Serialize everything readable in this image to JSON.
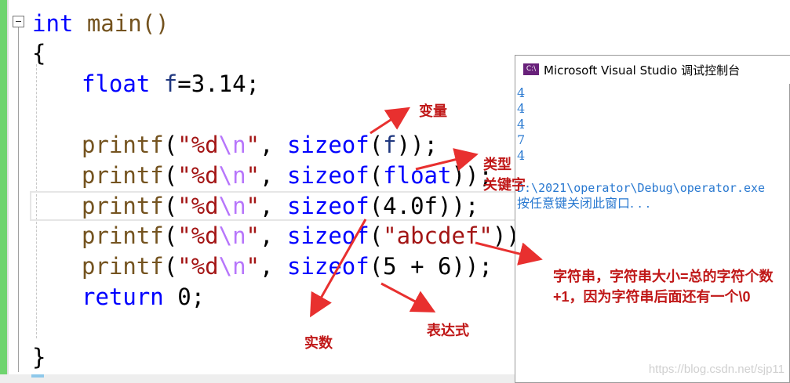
{
  "editor": {
    "lines": [
      {
        "id": "l1",
        "parts": [
          {
            "t": "int",
            "c": "kw"
          },
          {
            "t": " main()",
            "c": "fn"
          }
        ]
      },
      {
        "id": "l2",
        "parts": [
          {
            "t": "{",
            "c": "num"
          }
        ]
      },
      {
        "id": "l3",
        "parts": [
          {
            "t": "float",
            "c": "kw"
          },
          {
            "t": " f",
            "c": "var"
          },
          {
            "t": "=3.14;",
            "c": "num"
          }
        ]
      },
      {
        "id": "l4",
        "parts": []
      },
      {
        "id": "l5",
        "parts": [
          {
            "t": "printf",
            "c": "fn"
          },
          {
            "t": "(",
            "c": "num"
          },
          {
            "t": "\"%d",
            "c": "str"
          },
          {
            "t": "\\n",
            "c": "esc"
          },
          {
            "t": "\"",
            "c": "str"
          },
          {
            "t": ", ",
            "c": "num"
          },
          {
            "t": "sizeof",
            "c": "kw"
          },
          {
            "t": "(",
            "c": "num"
          },
          {
            "t": "f",
            "c": "var"
          },
          {
            "t": "));",
            "c": "num"
          }
        ]
      },
      {
        "id": "l6",
        "parts": [
          {
            "t": "printf",
            "c": "fn"
          },
          {
            "t": "(",
            "c": "num"
          },
          {
            "t": "\"%d",
            "c": "str"
          },
          {
            "t": "\\n",
            "c": "esc"
          },
          {
            "t": "\"",
            "c": "str"
          },
          {
            "t": ", ",
            "c": "num"
          },
          {
            "t": "sizeof",
            "c": "kw"
          },
          {
            "t": "(",
            "c": "num"
          },
          {
            "t": "float",
            "c": "kw"
          },
          {
            "t": "));",
            "c": "num"
          }
        ]
      },
      {
        "id": "l7",
        "parts": [
          {
            "t": "printf",
            "c": "fn"
          },
          {
            "t": "(",
            "c": "num"
          },
          {
            "t": "\"%d",
            "c": "str"
          },
          {
            "t": "\\n",
            "c": "esc"
          },
          {
            "t": "\"",
            "c": "str"
          },
          {
            "t": ", ",
            "c": "num"
          },
          {
            "t": "sizeof",
            "c": "kw"
          },
          {
            "t": "(4.0f));",
            "c": "num"
          }
        ]
      },
      {
        "id": "l8",
        "parts": [
          {
            "t": "printf",
            "c": "fn"
          },
          {
            "t": "(",
            "c": "num"
          },
          {
            "t": "\"%d",
            "c": "str"
          },
          {
            "t": "\\n",
            "c": "esc"
          },
          {
            "t": "\"",
            "c": "str"
          },
          {
            "t": ", ",
            "c": "num"
          },
          {
            "t": "sizeof",
            "c": "kw"
          },
          {
            "t": "(",
            "c": "num"
          },
          {
            "t": "\"abcdef\"",
            "c": "str"
          },
          {
            "t": "));",
            "c": "num"
          }
        ]
      },
      {
        "id": "l9",
        "parts": [
          {
            "t": "printf",
            "c": "fn"
          },
          {
            "t": "(",
            "c": "num"
          },
          {
            "t": "\"%d",
            "c": "str"
          },
          {
            "t": "\\n",
            "c": "esc"
          },
          {
            "t": "\"",
            "c": "str"
          },
          {
            "t": ", ",
            "c": "num"
          },
          {
            "t": "sizeof",
            "c": "kw"
          },
          {
            "t": "(5 + 6));",
            "c": "num"
          }
        ]
      },
      {
        "id": "l10",
        "parts": [
          {
            "t": "return",
            "c": "kw"
          },
          {
            "t": " 0;",
            "c": "num"
          }
        ]
      },
      {
        "id": "l11",
        "parts": []
      },
      {
        "id": "l12",
        "parts": [
          {
            "t": "}",
            "c": "num"
          }
        ]
      }
    ]
  },
  "annotations": {
    "variable": "变量",
    "type_keyword_1": "类型",
    "type_keyword_2": "关键字",
    "real_number": "实数",
    "expression": "表达式",
    "string_note": "字符串，字符串大小=总的字符个数+1，因为字符串后面还有一个\\0"
  },
  "console": {
    "title": "Microsoft Visual Studio 调试控制台",
    "icon_label": "C:\\",
    "outputs": [
      "4",
      "4",
      "4",
      "7",
      "4"
    ],
    "path_line": "D:\\2021\\operator\\Debug\\operator.exe",
    "prompt": "按任意键关闭此窗口. . ."
  },
  "watermark": "https://blog.csdn.net/sjp11",
  "colors": {
    "keyword": "#0000ff",
    "function": "#74531f",
    "string": "#a31515",
    "escape": "#b776fb",
    "variable": "#1f377f",
    "annotation": "#c01818",
    "arrow": "#e8302f",
    "console_text": "#2878d0",
    "gutter": "#6fd46f"
  }
}
